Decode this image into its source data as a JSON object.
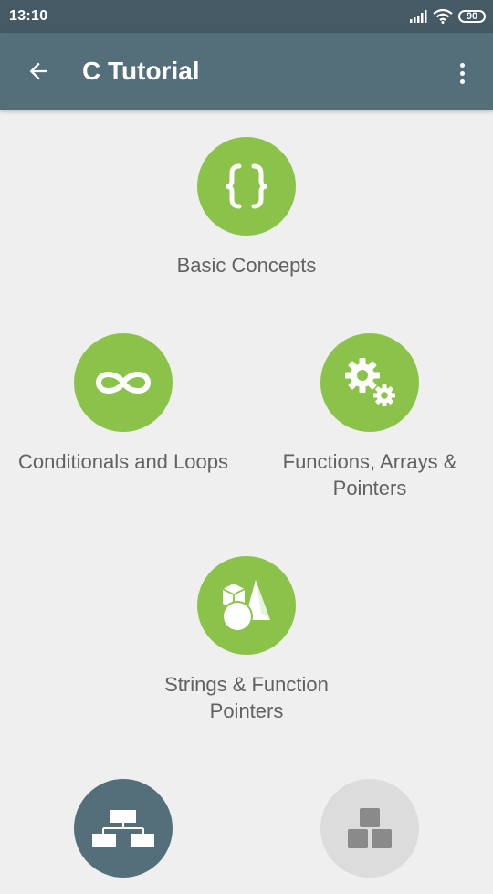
{
  "status_bar": {
    "time": "13:10",
    "battery": "90"
  },
  "app_bar": {
    "title": "C Tutorial",
    "back_icon": "arrow-back-icon",
    "menu_icon": "more-vert-icon"
  },
  "topics": [
    {
      "label": "Basic Concepts",
      "icon": "curly-braces-icon",
      "state": "unlocked"
    },
    {
      "label": "Conditionals and Loops",
      "icon": "infinity-icon",
      "state": "unlocked"
    },
    {
      "label": "Functions, Arrays & Pointers",
      "icon": "gears-icon",
      "state": "unlocked"
    },
    {
      "label": "Strings & Function Pointers",
      "icon": "shapes-icon",
      "state": "unlocked"
    },
    {
      "label": "",
      "icon": "hierarchy-icon",
      "state": "current"
    },
    {
      "label": "",
      "icon": "blocks-icon",
      "state": "locked"
    }
  ],
  "colors": {
    "status_bar": "#455a64",
    "app_bar": "#546e7a",
    "unlocked": "#8bc34a",
    "current": "#546e7a",
    "locked": "#dcdcdc",
    "background": "#efefef"
  }
}
